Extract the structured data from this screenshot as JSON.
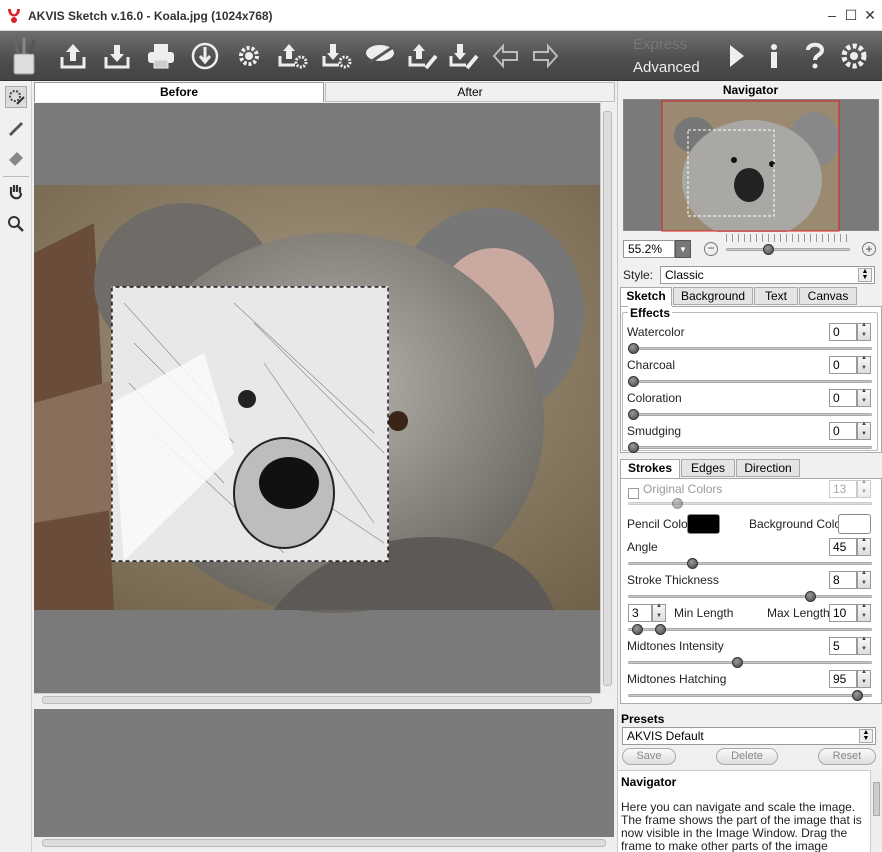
{
  "window": {
    "title": "AKVIS Sketch v.16.0 - Koala.jpg (1024x768)"
  },
  "toolbar": {
    "mode_express": "Express",
    "mode_advanced": "Advanced"
  },
  "view_tabs": {
    "before": "Before",
    "after": "After"
  },
  "navigator": {
    "title": "Navigator",
    "zoom": "55.2%",
    "zoom_level": 0.35
  },
  "style": {
    "label": "Style:",
    "value": "Classic"
  },
  "main_tabs": {
    "sketch": "Sketch",
    "background": "Background",
    "text": "Text",
    "canvas": "Canvas"
  },
  "effects": {
    "title": "Effects",
    "items": [
      {
        "label": "Watercolor",
        "value": "0"
      },
      {
        "label": "Charcoal",
        "value": "0"
      },
      {
        "label": "Coloration",
        "value": "0"
      },
      {
        "label": "Smudging",
        "value": "0"
      }
    ]
  },
  "stroke_tabs": {
    "strokes": "Strokes",
    "edges": "Edges",
    "direction": "Direction"
  },
  "strokes": {
    "original_colors": "Original Colors",
    "original_colors_value": "13",
    "pencil_color": "Pencil Color",
    "background_color": "Background Color",
    "pencil_color_hex": "#000000",
    "background_color_hex": "#ffffff",
    "angle": "Angle",
    "angle_value": "45",
    "thickness": "Stroke Thickness",
    "thickness_value": "8",
    "min_length": "Min Length",
    "min_length_value": "3",
    "max_length": "Max Length",
    "max_length_value": "10",
    "midtones_intensity": "Midtones Intensity",
    "midtones_intensity_value": "5",
    "midtones_hatching": "Midtones Hatching",
    "midtones_hatching_value": "95"
  },
  "presets": {
    "title": "Presets",
    "value": "AKVIS Default",
    "save": "Save",
    "delete": "Delete",
    "reset": "Reset"
  },
  "help": {
    "title": "Navigator",
    "text": "Here you can navigate and scale the image. The frame shows the part of the image that is now visible in the Image Window. Drag the frame to make other parts of the image visible. Use the"
  }
}
